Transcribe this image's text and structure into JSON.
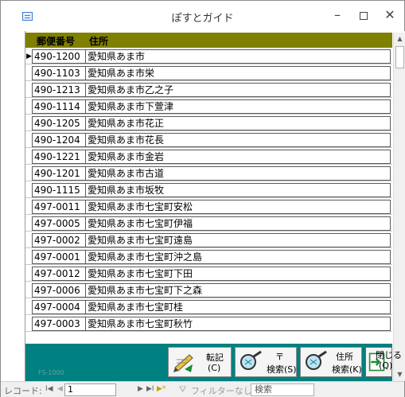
{
  "window": {
    "title": "ぽすとガイド",
    "minimize": "–",
    "close": "✕"
  },
  "header": {
    "zip_label": "郵便番号",
    "address_label": "住所"
  },
  "rows": [
    {
      "zip": "490-1200",
      "address": "愛知県あま市",
      "selected": "▶"
    },
    {
      "zip": "490-1103",
      "address": "愛知県あま市栄",
      "selected": ""
    },
    {
      "zip": "490-1213",
      "address": "愛知県あま市乙之子",
      "selected": ""
    },
    {
      "zip": "490-1114",
      "address": "愛知県あま市下萱津",
      "selected": ""
    },
    {
      "zip": "490-1205",
      "address": "愛知県あま市花正",
      "selected": ""
    },
    {
      "zip": "490-1204",
      "address": "愛知県あま市花長",
      "selected": ""
    },
    {
      "zip": "490-1221",
      "address": "愛知県あま市金岩",
      "selected": ""
    },
    {
      "zip": "490-1201",
      "address": "愛知県あま市古道",
      "selected": ""
    },
    {
      "zip": "490-1115",
      "address": "愛知県あま市坂牧",
      "selected": ""
    },
    {
      "zip": "497-0011",
      "address": "愛知県あま市七宝町安松",
      "selected": ""
    },
    {
      "zip": "497-0005",
      "address": "愛知県あま市七宝町伊福",
      "selected": ""
    },
    {
      "zip": "497-0002",
      "address": "愛知県あま市七宝町遠島",
      "selected": ""
    },
    {
      "zip": "497-0001",
      "address": "愛知県あま市七宝町沖之島",
      "selected": ""
    },
    {
      "zip": "497-0012",
      "address": "愛知県あま市七宝町下田",
      "selected": ""
    },
    {
      "zip": "497-0006",
      "address": "愛知県あま市七宝町下之森",
      "selected": ""
    },
    {
      "zip": "497-0004",
      "address": "愛知県あま市七宝町桂",
      "selected": ""
    },
    {
      "zip": "497-0003",
      "address": "愛知県あま市七宝町秋竹",
      "selected": ""
    }
  ],
  "footer": {
    "form_code": "FS-1000",
    "transcribe": {
      "line1": "転記",
      "line2": "(C)"
    },
    "search_zip": {
      "line1": "〒",
      "line2": "検索(S)"
    },
    "search_address": {
      "line1": "住所",
      "line2": "検索(K)"
    },
    "close": {
      "line1": "閉じる",
      "line2": "(Q)"
    }
  },
  "navigation": {
    "record_label": "レコード:",
    "first": "I◀",
    "prev": "◀",
    "current": "1",
    "next": "▶",
    "last": "▶I",
    "new": "▶*",
    "filter": "フィルターなし",
    "search_placeholder": "検索"
  },
  "colors": {
    "header_bg": "#808000",
    "footer_bg": "#008080"
  }
}
